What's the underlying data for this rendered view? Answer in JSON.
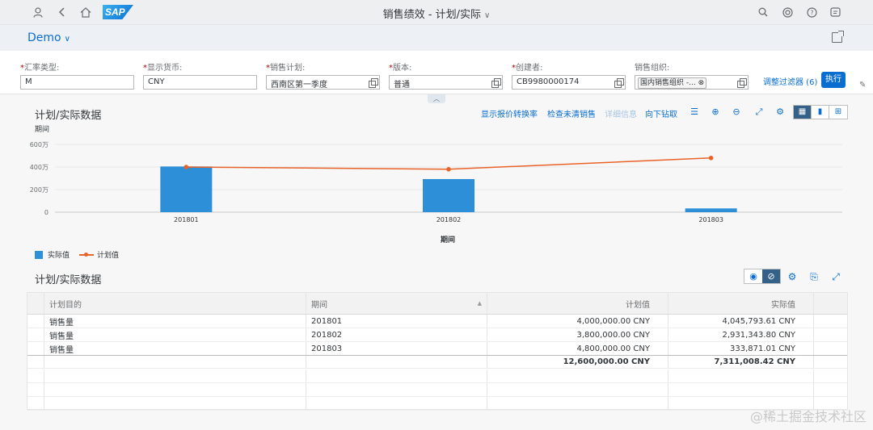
{
  "shell": {
    "title": "销售绩效 - 计划/实际",
    "logo": "SAP",
    "icons": [
      "user-icon",
      "back-icon",
      "home-icon",
      "search-icon",
      "notifications-icon",
      "help-icon",
      "copilot-icon"
    ]
  },
  "header": {
    "variant": "Demo"
  },
  "filters": [
    {
      "label": "汇率类型:",
      "value": "M",
      "required": true,
      "valuehelp": false
    },
    {
      "label": "显示货币:",
      "value": "CNY",
      "required": true,
      "valuehelp": false
    },
    {
      "label": "销售计划:",
      "value": "西南区第一季度",
      "required": true,
      "valuehelp": true
    },
    {
      "label": "版本:",
      "value": "普通",
      "required": true,
      "valuehelp": true
    },
    {
      "label": "创建者:",
      "value": "CB9980000174",
      "required": true,
      "valuehelp": true
    },
    {
      "label": "销售组织:",
      "value": "国内销售组织 -...",
      "required": false,
      "valuehelp": true,
      "token": true
    }
  ],
  "filterbar": {
    "adapt_label": "调整过滤器 (6)",
    "go_label": "执行"
  },
  "chart_section": {
    "title": "计划/实际数据",
    "toolbar_links": [
      "显示报价转换率",
      "检查未清销售",
      "详细信息",
      "向下钻取"
    ]
  },
  "chart_data": {
    "type": "bar",
    "title": "",
    "subtitle": "期间",
    "xlabel": "期间",
    "ylabel": "",
    "categories": [
      "201801",
      "201802",
      "201803"
    ],
    "ytick_labels": [
      "0",
      "200万",
      "400万",
      "600万"
    ],
    "ylim": [
      0,
      6000000
    ],
    "grid": true,
    "legend": "bottom-left",
    "series": [
      {
        "name": "实际值",
        "type": "bar",
        "color": "#2c8fd8",
        "values": [
          4045793.61,
          2931343.8,
          333871.01
        ]
      },
      {
        "name": "计划值",
        "type": "line",
        "color": "#e9622a",
        "values": [
          4000000,
          3800000,
          4800000
        ]
      }
    ]
  },
  "table_section": {
    "title": "计划/实际数据",
    "columns": [
      "计划目的",
      "期间",
      "计划值",
      "实际值"
    ],
    "rows": [
      {
        "purpose": "销售量",
        "period": "201801",
        "plan": "4,000,000.00  CNY",
        "actual": "4,045,793.61  CNY"
      },
      {
        "purpose": "销售量",
        "period": "201802",
        "plan": "3,800,000.00  CNY",
        "actual": "2,931,343.80  CNY"
      },
      {
        "purpose": "销售量",
        "period": "201803",
        "plan": "4,800,000.00  CNY",
        "actual": "333,871.01  CNY"
      }
    ],
    "totals": {
      "plan": "12,600,000.00  CNY",
      "actual": "7,311,008.42  CNY"
    }
  },
  "watermark": "@稀土掘金技术社区"
}
